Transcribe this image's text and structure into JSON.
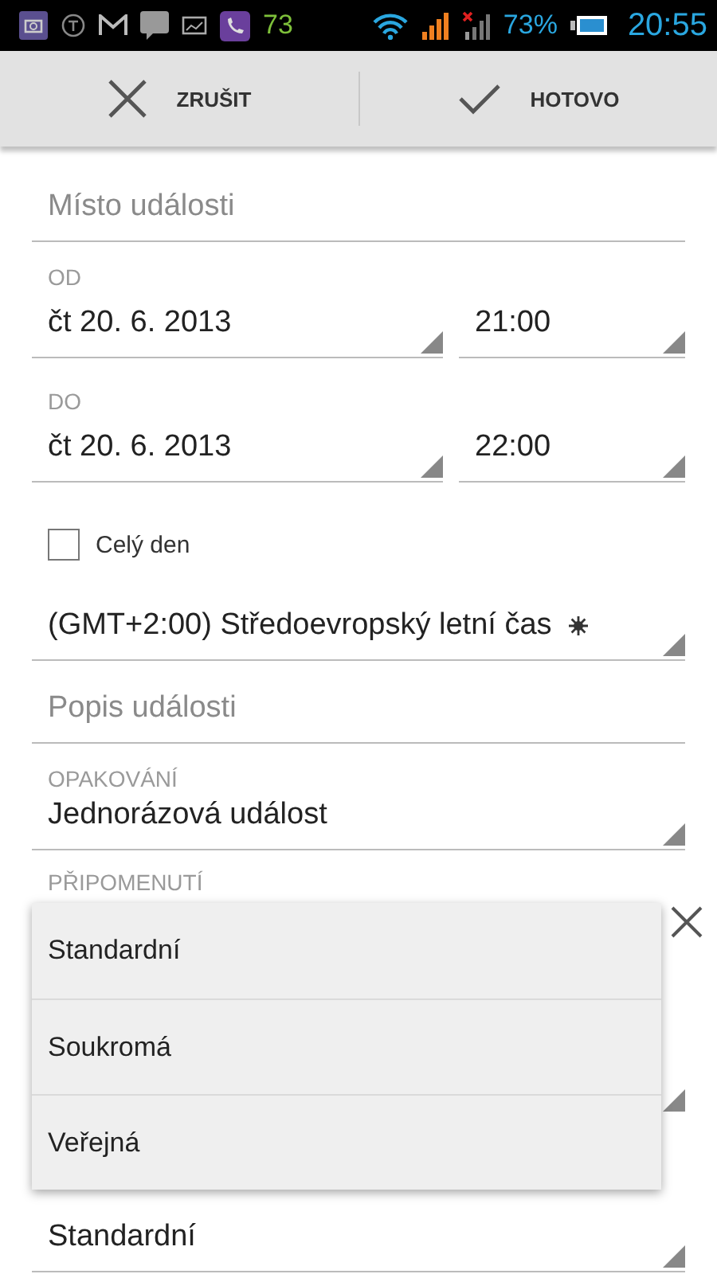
{
  "status_bar": {
    "notification_count": "73",
    "battery": "73%",
    "time": "20:55"
  },
  "action_bar": {
    "buttons": [
      {
        "label": "ZRUŠIT",
        "kind": "cancel"
      },
      {
        "label": "HOTOVO",
        "kind": "done"
      }
    ]
  },
  "form": [
    {
      "kind": "text",
      "placeholder": "Místo události"
    },
    {
      "kind": "datetime",
      "label": "OD",
      "date": "čt 20. 6. 2013",
      "time": "21:00"
    },
    {
      "kind": "datetime",
      "label": "DO",
      "date": "čt 20. 6. 2013",
      "time": "22:00"
    },
    {
      "kind": "checkbox",
      "label": "Celý den",
      "checked": false
    },
    {
      "kind": "spinner",
      "value": "(GMT+2:00) Středoevropský letní čas",
      "sun": true
    },
    {
      "kind": "text",
      "placeholder": "Popis události"
    },
    {
      "kind": "spinner",
      "label": "OPAKOVÁNÍ",
      "value": "Jednorázová událost"
    },
    {
      "kind": "reminder",
      "label": "PŘIPOMENUTÍ"
    },
    {
      "kind": "spinner",
      "value": "Standardní"
    }
  ],
  "popup": {
    "options": [
      {
        "label": "Standardní",
        "selected": false
      },
      {
        "label": "Soukromá",
        "selected": false
      },
      {
        "label": "Veřejná",
        "selected": false
      }
    ]
  }
}
